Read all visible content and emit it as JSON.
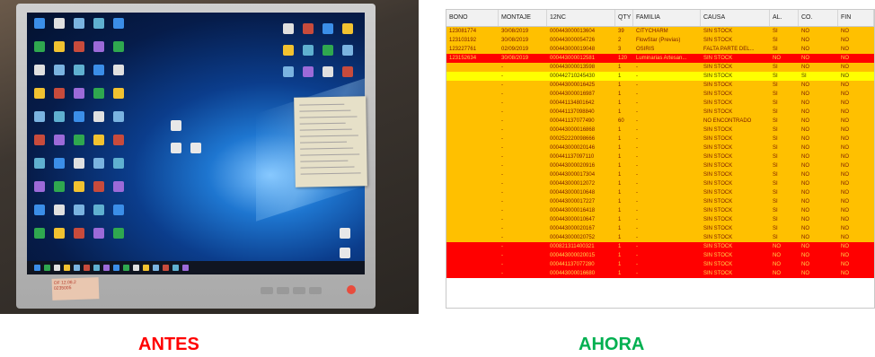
{
  "photo": {
    "description_icon": "monitor-photo",
    "sticky_note_lines": 12,
    "sticker_text": [
      "OF 12.08.2",
      "0235005"
    ]
  },
  "table": {
    "columns": [
      "BONO",
      "MONTAJE",
      "12NC",
      "QTY",
      "FAMILIA",
      "CAUSA",
      "AL.",
      "CO.",
      "FIN"
    ],
    "rows": [
      {
        "style": "orange",
        "cells": [
          "123081774",
          "30/08/2019",
          "000443000013604",
          "39",
          "CITYCHARM",
          "SIN STOCK",
          "SI",
          "NO",
          "NO"
        ]
      },
      {
        "style": "orange",
        "cells": [
          "123103192",
          "30/08/2019",
          "000443000054726",
          "2",
          "FlowStar (Previas)",
          "SIN STOCK",
          "SI",
          "NO",
          "NO"
        ]
      },
      {
        "style": "orange",
        "cells": [
          "123227761",
          "02/09/2019",
          "000443000019048",
          "3",
          "OSIRIS",
          "FALTA PARTE DEL...",
          "SI",
          "NO",
          "NO"
        ]
      },
      {
        "style": "red",
        "cells": [
          "123152634",
          "30/08/2019",
          "000443000012581",
          "120",
          "Luminarias Artesan...",
          "SIN STOCK",
          "NO",
          "NO",
          "NO"
        ]
      },
      {
        "style": "orange",
        "cells": [
          "",
          "-",
          "000443000013598",
          "1",
          "-",
          "SIN STOCK",
          "SI",
          "NO",
          "NO"
        ]
      },
      {
        "style": "yellow",
        "cells": [
          "",
          "-",
          "000442710245430",
          "1",
          "-",
          "SIN STOCK",
          "SI",
          "SI",
          "NO"
        ]
      },
      {
        "style": "orange",
        "cells": [
          "",
          "-",
          "000443000016425",
          "1",
          "-",
          "SIN STOCK",
          "SI",
          "NO",
          "NO"
        ]
      },
      {
        "style": "orange",
        "cells": [
          "",
          "-",
          "000443000016987",
          "1",
          "-",
          "SIN STOCK",
          "SI",
          "NO",
          "NO"
        ]
      },
      {
        "style": "orange",
        "cells": [
          "",
          "-",
          "000441134801642",
          "1",
          "-",
          "SIN STOCK",
          "SI",
          "NO",
          "NO"
        ]
      },
      {
        "style": "orange",
        "cells": [
          "",
          "-",
          "000441137098840",
          "1",
          "-",
          "SIN STOCK",
          "SI",
          "NO",
          "NO"
        ]
      },
      {
        "style": "orange",
        "cells": [
          "",
          "-",
          "000441137077490",
          "60",
          "-",
          "NO ENCONTRADO",
          "SI",
          "NO",
          "NO"
        ]
      },
      {
        "style": "orange",
        "cells": [
          "",
          "-",
          "000443000016868",
          "1",
          "-",
          "SIN STOCK",
          "SI",
          "NO",
          "NO"
        ]
      },
      {
        "style": "orange",
        "cells": [
          "",
          "-",
          "000252220098666",
          "1",
          "-",
          "SIN STOCK",
          "SI",
          "NO",
          "NO"
        ]
      },
      {
        "style": "orange",
        "cells": [
          "",
          "-",
          "000443000020146",
          "1",
          "-",
          "SIN STOCK",
          "SI",
          "NO",
          "NO"
        ]
      },
      {
        "style": "orange",
        "cells": [
          "",
          "-",
          "000441137097110",
          "1",
          "-",
          "SIN STOCK",
          "SI",
          "NO",
          "NO"
        ]
      },
      {
        "style": "orange",
        "cells": [
          "",
          "-",
          "000443000020916",
          "1",
          "-",
          "SIN STOCK",
          "SI",
          "NO",
          "NO"
        ]
      },
      {
        "style": "orange",
        "cells": [
          "",
          "-",
          "000443000017304",
          "1",
          "-",
          "SIN STOCK",
          "SI",
          "NO",
          "NO"
        ]
      },
      {
        "style": "orange",
        "cells": [
          "",
          "-",
          "000443000012072",
          "1",
          "-",
          "SIN STOCK",
          "SI",
          "NO",
          "NO"
        ]
      },
      {
        "style": "orange",
        "cells": [
          "",
          "-",
          "000443000010648",
          "1",
          "-",
          "SIN STOCK",
          "SI",
          "NO",
          "NO"
        ]
      },
      {
        "style": "orange",
        "cells": [
          "",
          "-",
          "000443000017227",
          "1",
          "-",
          "SIN STOCK",
          "SI",
          "NO",
          "NO"
        ]
      },
      {
        "style": "orange",
        "cells": [
          "",
          "-",
          "000443000016418",
          "1",
          "-",
          "SIN STOCK",
          "SI",
          "NO",
          "NO"
        ]
      },
      {
        "style": "orange",
        "cells": [
          "",
          "-",
          "000443000010647",
          "1",
          "-",
          "SIN STOCK",
          "SI",
          "NO",
          "NO"
        ]
      },
      {
        "style": "orange",
        "cells": [
          "",
          "-",
          "000443000020167",
          "1",
          "-",
          "SIN STOCK",
          "SI",
          "NO",
          "NO"
        ]
      },
      {
        "style": "orange",
        "cells": [
          "",
          "-",
          "000443000020752",
          "1",
          "-",
          "SIN STOCK",
          "SI",
          "NO",
          "NO"
        ]
      },
      {
        "style": "red",
        "cells": [
          "",
          "-",
          "000821311400321",
          "1",
          "-",
          "SIN STOCK",
          "NO",
          "NO",
          "NO"
        ]
      },
      {
        "style": "red",
        "cells": [
          "",
          "-",
          "000443000020015",
          "1",
          "-",
          "SIN STOCK",
          "NO",
          "NO",
          "NO"
        ]
      },
      {
        "style": "red",
        "cells": [
          "",
          "-",
          "000441137077280",
          "1",
          "-",
          "SIN STOCK",
          "NO",
          "NO",
          "NO"
        ]
      },
      {
        "style": "red",
        "cells": [
          "",
          "-",
          "000443000016680",
          "1",
          "-",
          "SIN STOCK",
          "NO",
          "NO",
          "NO"
        ]
      }
    ]
  },
  "captions": {
    "left": "ANTES",
    "right": "AHORA"
  },
  "colors": {
    "orange": "#ffc000",
    "red": "#ff0000",
    "yellow": "#ffff00",
    "antes": "#ff0000",
    "ahora": "#00b050"
  }
}
